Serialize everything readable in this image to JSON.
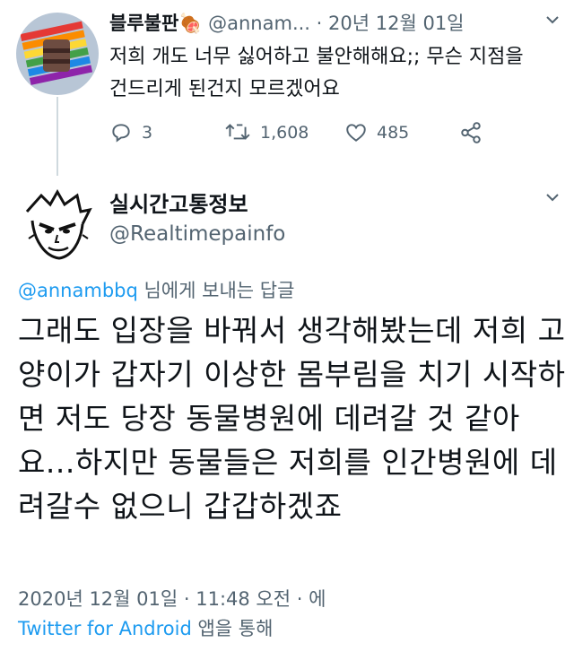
{
  "tweet1": {
    "name": "블루불판",
    "name_emoji": "🍖",
    "handle": "@annam...",
    "dot": "·",
    "date": "20년 12월 01일",
    "text": "저희 개도 너무 싫어하고 불안해해요;; 무슨 지점을 건드리게 된건지 모르겠어요",
    "replies": "3",
    "retweets": "1,608",
    "likes": "485"
  },
  "tweet2": {
    "name": "실시간고통정보",
    "handle": "@Realtimepainfo",
    "replying_mention": "@annambbq",
    "replying_suffix": " 님에게 보내는 답글",
    "text": "그래도 입장을 바꿔서 생각해봤는데 저희 고양이가 갑자기 이상한 몸부림을 치기 시작하면 저도 당장 동물병원에 데려갈 것 같아요...하지만 동물들은 저희를 인간병원에 데려갈수 없으니 갑갑하겠죠",
    "timestamp": "2020년 12월 01일 · 11:48 오전 · 에",
    "source": "Twitter for Android",
    "source_suffix": " 앱을 통해"
  },
  "colors": {
    "text": "#0f1419",
    "muted": "#536471",
    "link": "#1d9bf0"
  },
  "icons": [
    "reply-icon",
    "retweet-icon",
    "like-icon",
    "share-icon",
    "chevron-down-icon"
  ]
}
